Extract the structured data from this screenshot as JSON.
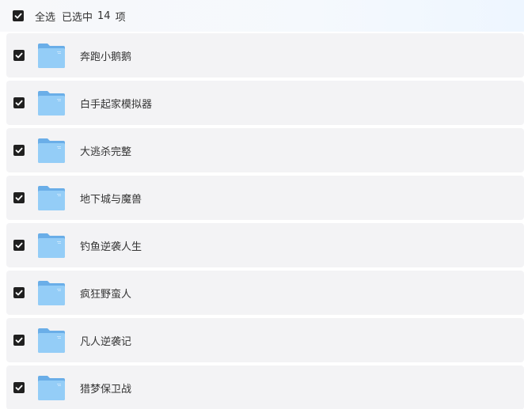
{
  "header": {
    "select_all_label": "全选",
    "selected_prefix": "已选中",
    "selected_count": "14",
    "selected_suffix": "项"
  },
  "colors": {
    "checkbox_fill": "#202020",
    "row_background": "#f3f3f5",
    "folder_back": "#6aaee8",
    "folder_front": "#94cdf7"
  },
  "icons": {
    "checkbox": "checkmark-icon",
    "folder": "folder-icon"
  },
  "files": [
    {
      "name": "奔跑小鹅鹅",
      "checked": true
    },
    {
      "name": "白手起家模拟器",
      "checked": true
    },
    {
      "name": "大逃杀完整",
      "checked": true
    },
    {
      "name": "地下城与魔兽",
      "checked": true
    },
    {
      "name": "钓鱼逆袭人生",
      "checked": true
    },
    {
      "name": "疯狂野蛮人",
      "checked": true
    },
    {
      "name": "凡人逆袭记",
      "checked": true
    },
    {
      "name": "猎梦保卫战",
      "checked": true
    }
  ]
}
